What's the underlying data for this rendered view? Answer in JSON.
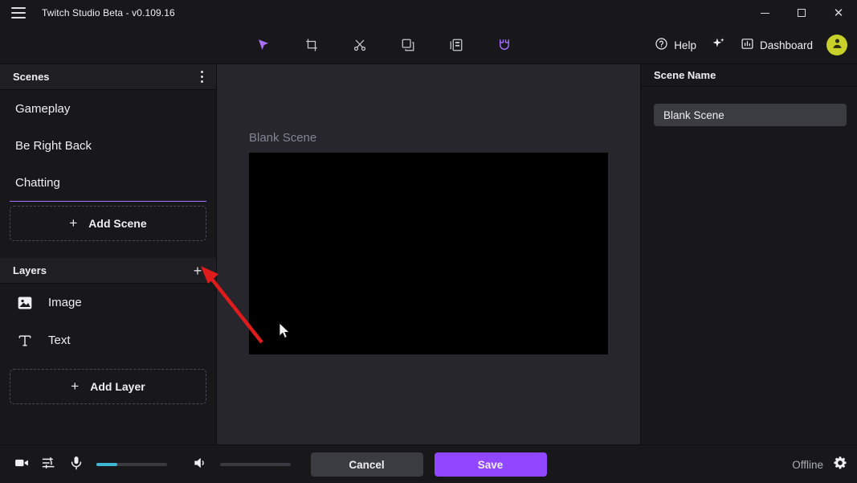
{
  "window": {
    "title": "Twitch Studio Beta - v0.109.16",
    "menu_icon": "hamburger-icon",
    "controls": {
      "minimize": "–",
      "maximize": "□",
      "close": "×"
    }
  },
  "toolbar": {
    "tools": [
      {
        "name": "select-tool",
        "icon": "cursor-arrow-icon",
        "active": true
      },
      {
        "name": "crop-tool",
        "icon": "crop-icon",
        "active": false
      },
      {
        "name": "cut-tool",
        "icon": "scissors-icon",
        "active": false
      },
      {
        "name": "duplicate-tool",
        "icon": "copy-icon",
        "active": false
      },
      {
        "name": "layers-tool",
        "icon": "layers-list-icon",
        "active": false
      },
      {
        "name": "snap-tool",
        "icon": "magnet-icon",
        "active": true
      }
    ],
    "accent": "#9147ff"
  },
  "header_right": {
    "help_label": "Help",
    "help_icon": "question-circle-icon",
    "sparkle_icon": "sparkle-icon",
    "dashboard_label": "Dashboard",
    "dashboard_icon": "bar-chart-icon",
    "avatar_icon": "user-avatar-icon",
    "avatar_color": "#c8d02a"
  },
  "scenes_panel": {
    "title": "Scenes",
    "menu_icon": "kebab-menu-icon",
    "items": [
      {
        "label": "Gameplay"
      },
      {
        "label": "Be Right Back"
      },
      {
        "label": "Chatting"
      }
    ],
    "add_label": "Add Scene",
    "add_icon": "plus-icon",
    "drop_indicator_color": "#a970ff"
  },
  "layers_panel": {
    "title": "Layers",
    "add_icon": "plus-icon",
    "items": [
      {
        "label": "Image",
        "icon": "image-icon"
      },
      {
        "label": "Text",
        "icon": "text-t-icon"
      }
    ],
    "add_label": "Add Layer"
  },
  "canvas": {
    "scene_label": "Blank Scene",
    "preview_background": "#000000"
  },
  "right_panel": {
    "title": "Scene Name",
    "scene_name_value": "Blank Scene",
    "scene_name_placeholder": "Scene Name"
  },
  "bottom_bar": {
    "camera_icon": "video-camera-icon",
    "settings_icon": "audio-sliders-icon",
    "mic_icon": "microphone-icon",
    "mic_level_percent": 30,
    "mic_level_color": "#3fb6d3",
    "speaker_icon": "speaker-icon",
    "speaker_level_percent": 0,
    "cancel_label": "Cancel",
    "save_label": "Save",
    "save_color": "#9147ff",
    "status_label": "Offline",
    "gear_icon": "gear-icon"
  },
  "annotation": {
    "arrow_color": "#e01b1b",
    "arrow_target": "layers-add-button",
    "cursor_icon": "mouse-pointer-icon"
  }
}
